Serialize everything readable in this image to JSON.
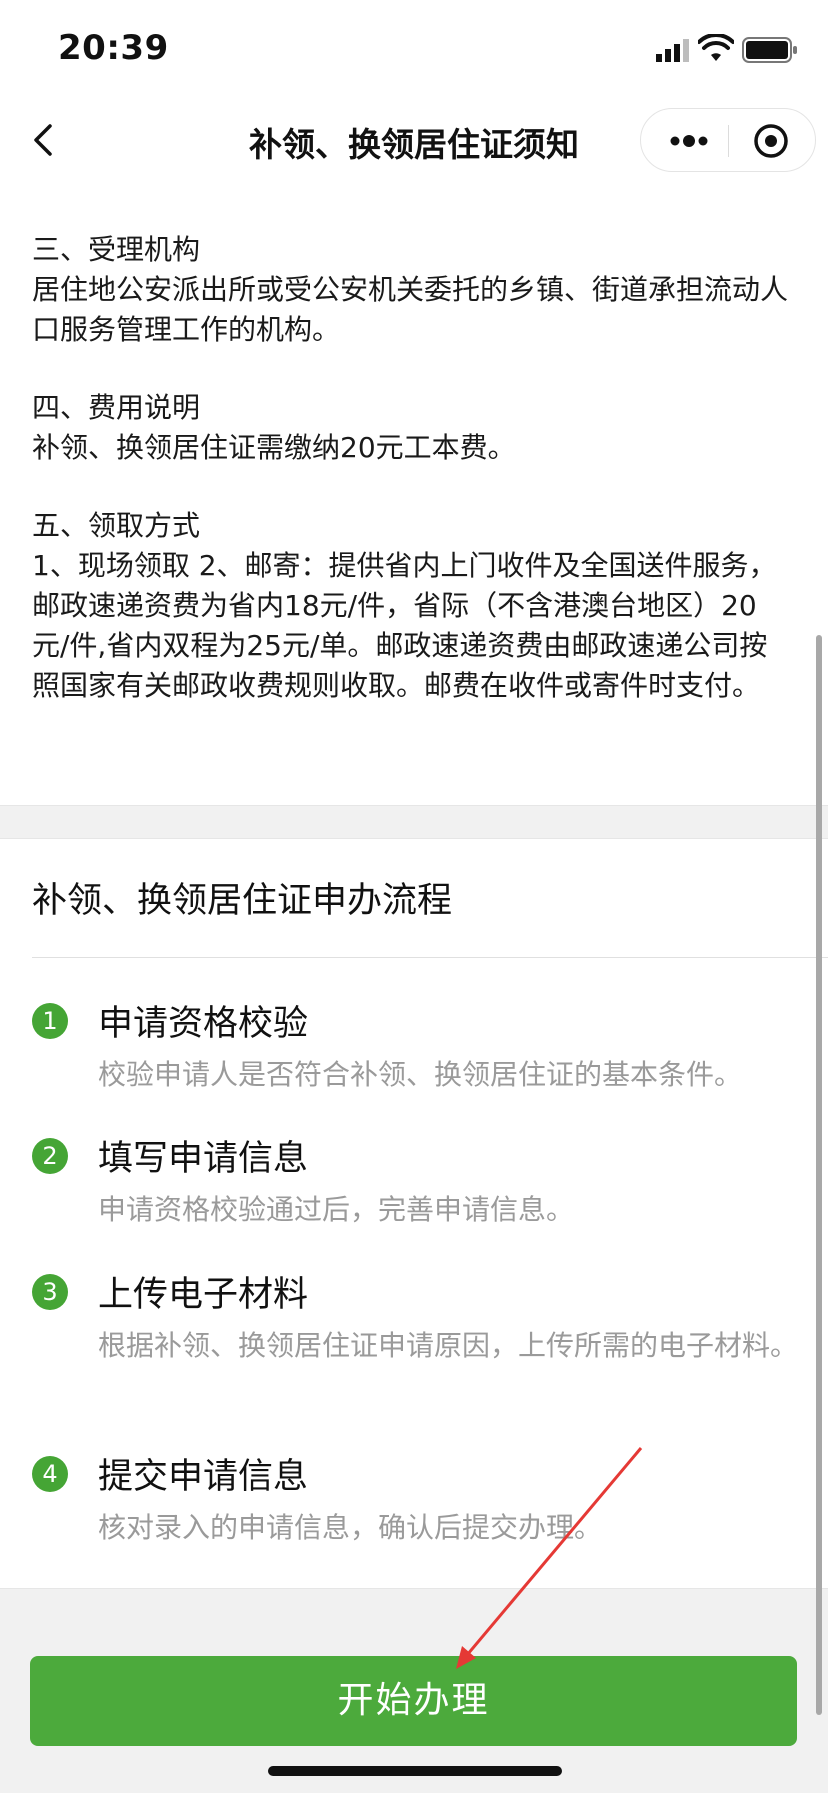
{
  "status_bar": {
    "time": "20:39"
  },
  "nav": {
    "title": "补领、换领居住证须知"
  },
  "notice": {
    "sections": [
      {
        "heading": "三、受理机构",
        "body": "居住地公安派出所或受公安机关委托的乡镇、街道承担流动人口服务管理工作的机构。"
      },
      {
        "heading": "四、费用说明",
        "body": "补领、换领居住证需缴纳20元工本费。"
      },
      {
        "heading": "五、领取方式",
        "body": "1、现场领取 2、邮寄：提供省内上门收件及全国送件服务，邮政速递资费为省内18元/件，省际（不含港澳台地区）20元/件,省内双程为25元/单。邮政速递资费由邮政速递公司按照国家有关邮政收费规则收取。邮费在收件或寄件时支付。"
      }
    ]
  },
  "process": {
    "title": "补领、换领居住证申办流程",
    "steps": [
      {
        "num": "1",
        "title": "申请资格校验",
        "desc": "校验申请人是否符合补领、换领居住证的基本条件。"
      },
      {
        "num": "2",
        "title": "填写申请信息",
        "desc": "申请资格校验通过后，完善申请信息。"
      },
      {
        "num": "3",
        "title": "上传电子材料",
        "desc": "根据补领、换领居住证申请原因，上传所需的电子材料。"
      },
      {
        "num": "4",
        "title": "提交申请信息",
        "desc": "核对录入的申请信息，确认后提交办理。"
      }
    ]
  },
  "actions": {
    "start_label": "开始办理"
  },
  "colors": {
    "accent": "#4caa3c",
    "annotation_arrow": "#e53935"
  }
}
